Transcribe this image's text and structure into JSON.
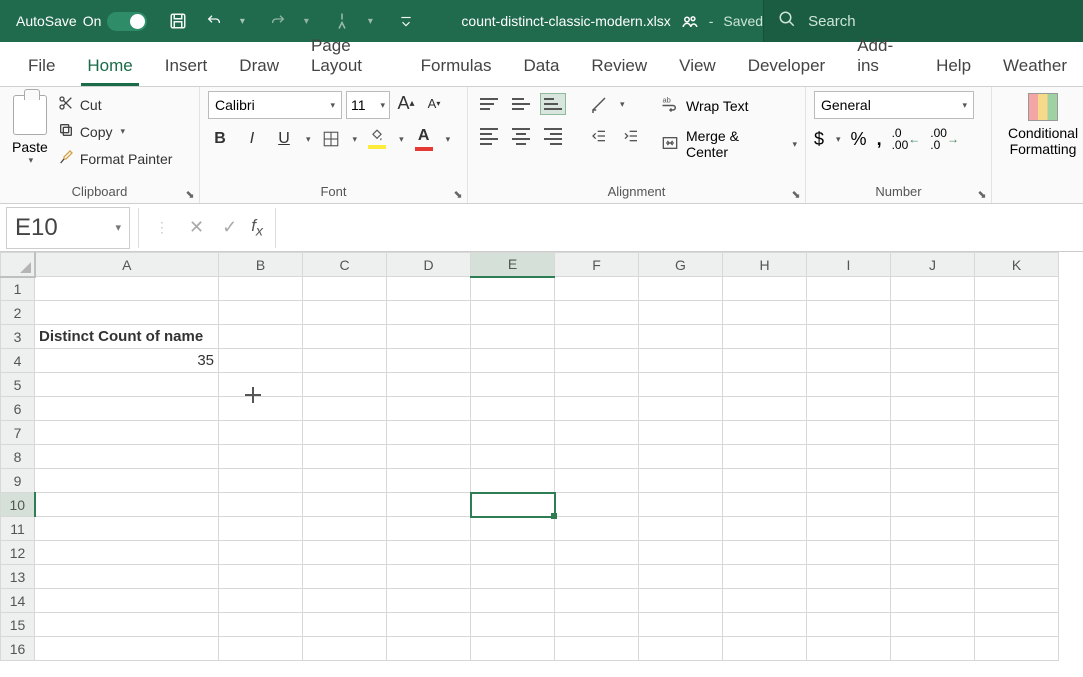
{
  "titlebar": {
    "autosave_label": "AutoSave",
    "autosave_state": "On",
    "filename": "count-distinct-classic-modern.xlsx",
    "saved_status": "Saved",
    "search_placeholder": "Search"
  },
  "tabs": [
    "File",
    "Home",
    "Insert",
    "Draw",
    "Page Layout",
    "Formulas",
    "Data",
    "Review",
    "View",
    "Developer",
    "Add-ins",
    "Help",
    "Weather"
  ],
  "active_tab": "Home",
  "ribbon": {
    "clipboard": {
      "paste": "Paste",
      "cut": "Cut",
      "copy": "Copy",
      "fp": "Format Painter",
      "label": "Clipboard"
    },
    "font": {
      "name": "Calibri",
      "size": "11",
      "label": "Font"
    },
    "alignment": {
      "wrap": "Wrap Text",
      "merge": "Merge & Center",
      "label": "Alignment"
    },
    "number": {
      "format": "General",
      "label": "Number"
    },
    "cond": {
      "l1": "Conditional",
      "l2": "Formatting"
    }
  },
  "formula_bar": {
    "name_box": "E10",
    "formula": ""
  },
  "columns": [
    "A",
    "B",
    "C",
    "D",
    "E",
    "F",
    "G",
    "H",
    "I",
    "J",
    "K"
  ],
  "active_col": "E",
  "rows": [
    "1",
    "2",
    "3",
    "4",
    "5",
    "6",
    "7",
    "8",
    "9",
    "10",
    "11",
    "12",
    "13",
    "14",
    "15",
    "16"
  ],
  "active_row": "10",
  "cells": {
    "A3": "Distinct Count of name",
    "A4": "35"
  },
  "selected_cell": "E10"
}
